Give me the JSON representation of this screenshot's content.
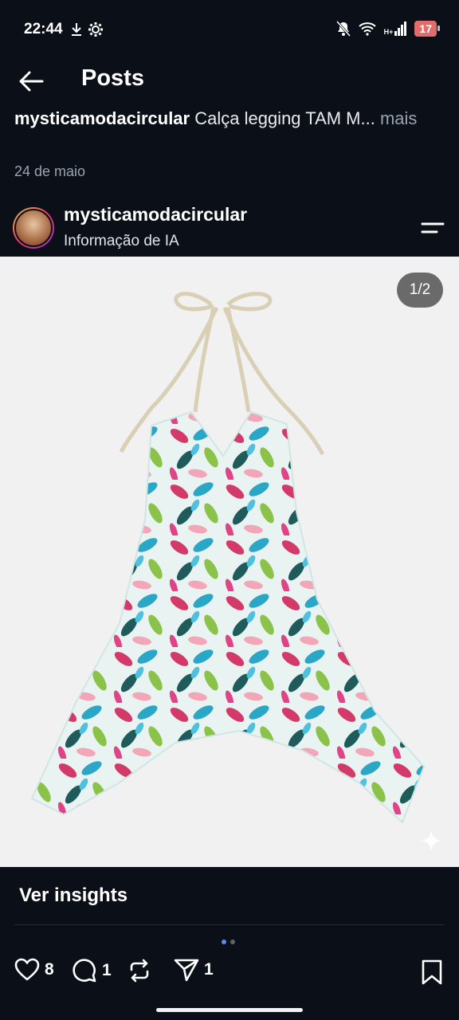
{
  "status": {
    "time": "22:44",
    "network": "H+",
    "battery": "17"
  },
  "header": {
    "title": "Posts"
  },
  "caption": {
    "username": "mysticamodacircular",
    "text": "Calça legging TAM M...",
    "more": "mais",
    "date": "24 de maio"
  },
  "author": {
    "name": "mysticamodacircular",
    "subtitle": "Informação de IA"
  },
  "media": {
    "counter": "1/2"
  },
  "insights": {
    "label": "Ver insights"
  },
  "actions": {
    "likes": "8",
    "comments": "1",
    "reposts": "",
    "shares": "1"
  },
  "icons": [
    "download-icon",
    "settings-icon",
    "mute-icon",
    "wifi-icon",
    "signal-icon",
    "battery-icon",
    "back-arrow-icon",
    "menu-icon",
    "sparkle-icon",
    "heart-icon",
    "comment-icon",
    "repost-icon",
    "share-icon",
    "bookmark-icon"
  ]
}
